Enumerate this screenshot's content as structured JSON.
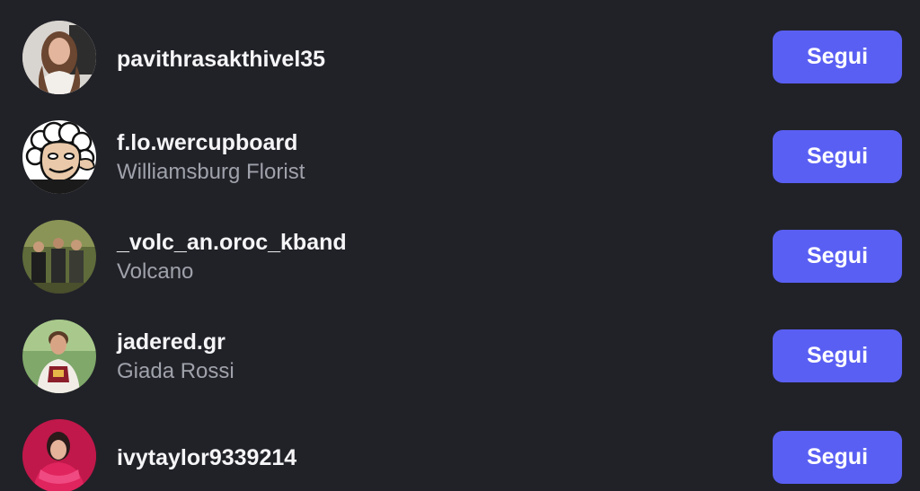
{
  "suggestions": [
    {
      "username": "pavithrasakthivel35",
      "full_name": "",
      "button_label": "Segui"
    },
    {
      "username": "f.lo.wercupboard",
      "full_name": "Williamsburg Florist",
      "button_label": "Segui"
    },
    {
      "username": "_volc_an.oroc_kband",
      "full_name": "Volcano",
      "button_label": "Segui"
    },
    {
      "username": "jadered.gr",
      "full_name": "Giada Rossi",
      "button_label": "Segui"
    },
    {
      "username": "ivytaylor9339214",
      "full_name": "",
      "button_label": "Segui"
    }
  ],
  "colors": {
    "background": "#212228",
    "button": "#5a5ff3",
    "username": "#f5f5f7",
    "secondary_text": "#a0a2ab"
  }
}
